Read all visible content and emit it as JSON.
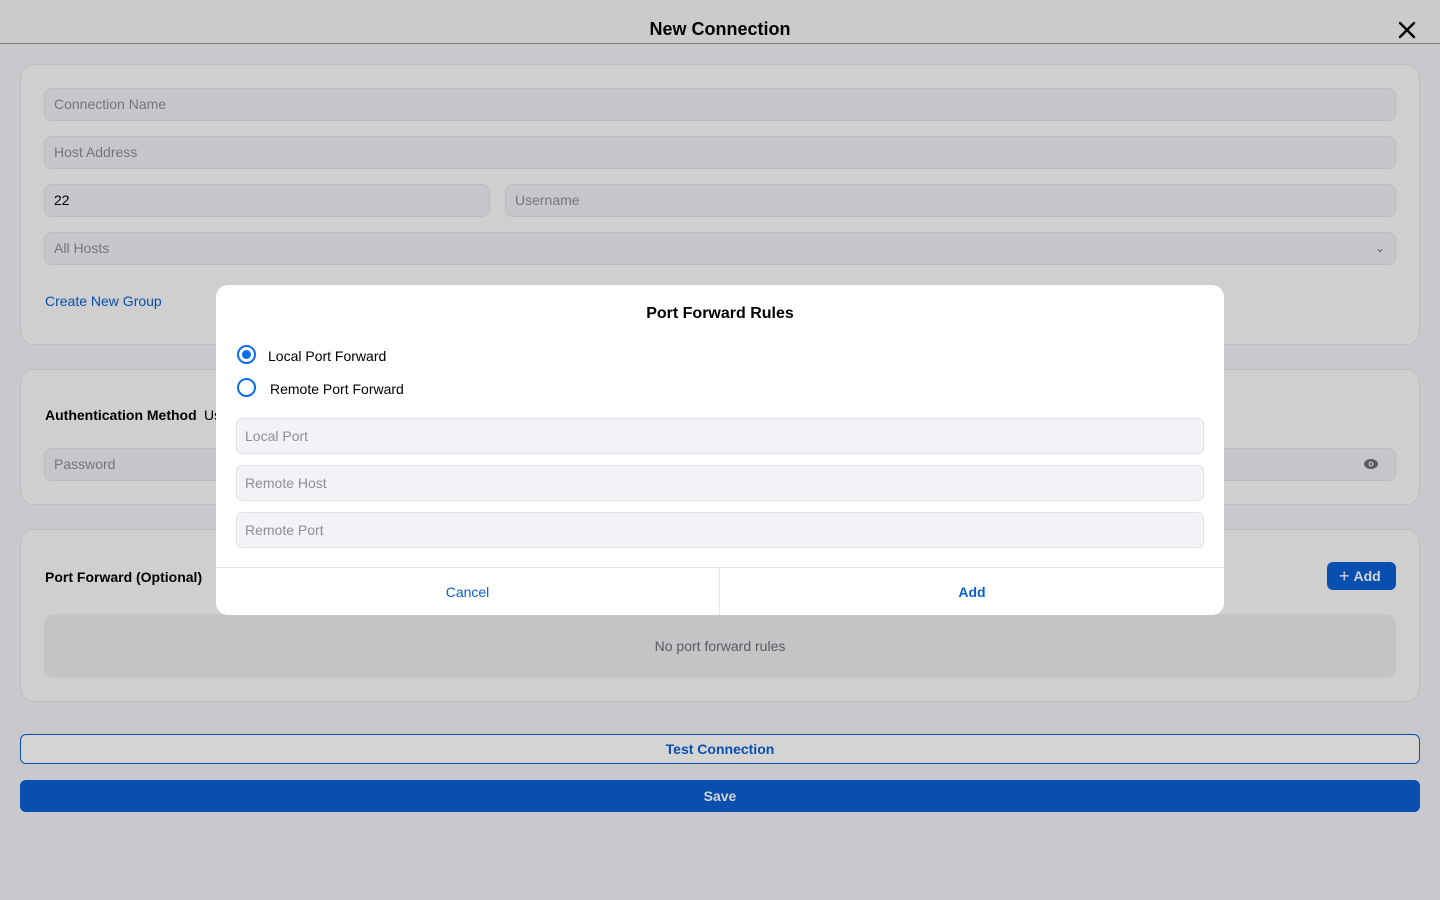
{
  "header": {
    "title": "New Connection",
    "close_icon": "close-icon"
  },
  "connection": {
    "name_placeholder": "Connection Name",
    "host_placeholder": "Host Address",
    "port_value": "22",
    "username_placeholder": "Username",
    "group_value": "All Hosts",
    "create_group_label": "Create New Group"
  },
  "auth": {
    "method_label": "Authentication Method",
    "method_value_partial": "Us",
    "password_placeholder": "Password",
    "eye_icon": "eye-icon"
  },
  "port_forward": {
    "title": "Port Forward (Optional)",
    "add_label": "Add",
    "empty_text": "No port forward rules"
  },
  "actions": {
    "test_label": "Test Connection",
    "save_label": "Save"
  },
  "modal": {
    "title": "Port Forward Rules",
    "options": [
      {
        "label": "Local Port Forward",
        "checked": true
      },
      {
        "label": "Remote Port Forward",
        "checked": false
      }
    ],
    "local_port_placeholder": "Local Port",
    "remote_host_placeholder": "Remote Host",
    "remote_port_placeholder": "Remote Port",
    "cancel_label": "Cancel",
    "add_label": "Add"
  },
  "colors": {
    "accent": "#0a5fd4",
    "radio": "#0a6cf2"
  }
}
